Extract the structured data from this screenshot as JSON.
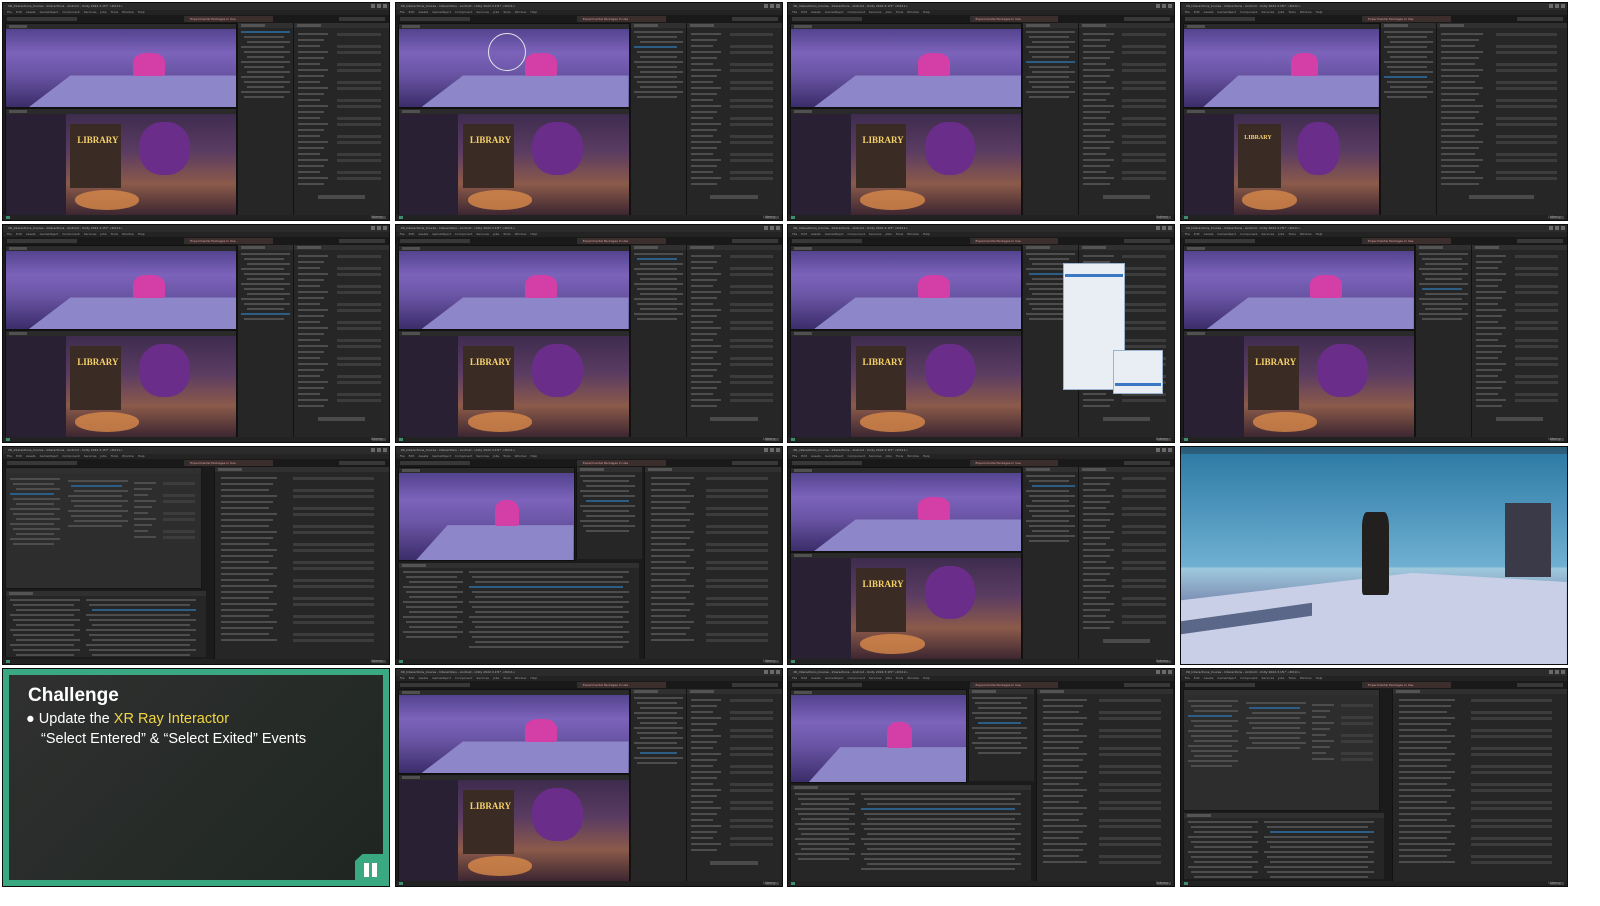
{
  "window": {
    "title": "XR_Interactions_Course - Interactions - Android - Unity 2022.3.1f1* <DX11>"
  },
  "menu": [
    "File",
    "Edit",
    "Assets",
    "GameObject",
    "Component",
    "Services",
    "Jobs",
    "Tools",
    "Window",
    "Help"
  ],
  "toolbar": {
    "experimental_label": "Experimental Packages In Use",
    "layers_label": "Layers",
    "layout_label": "Layout"
  },
  "scene": {
    "library_sign": "LIBRARY"
  },
  "challenge": {
    "title": "Challenge",
    "bullet": "●",
    "line1_before": "Update the ",
    "line1_highlight": "XR Ray Interactor",
    "line2": "“Select Entered” & “Select Exited” Events",
    "accent_color": "#3aa880",
    "highlight_color": "#f2d645",
    "pause_icon": "pause-icon"
  },
  "brand": "Udemy",
  "tiles": [
    {
      "id": "t1",
      "kind": "editor",
      "view": "dual",
      "panel": "inspector"
    },
    {
      "id": "t2",
      "kind": "editor",
      "view": "dual-gizmo",
      "panel": "inspector"
    },
    {
      "id": "t3",
      "kind": "editor",
      "view": "dual",
      "panel": "inspector"
    },
    {
      "id": "t4",
      "kind": "editor",
      "view": "dual",
      "panel": "inspector-wide"
    },
    {
      "id": "t5",
      "kind": "editor",
      "view": "dual",
      "panel": "inspector"
    },
    {
      "id": "t6",
      "kind": "editor",
      "view": "dual",
      "panel": "inspector"
    },
    {
      "id": "t7",
      "kind": "editor",
      "view": "dual",
      "panel": "inspector-dropdown"
    },
    {
      "id": "t8",
      "kind": "editor",
      "view": "dual",
      "panel": "inspector"
    },
    {
      "id": "t9",
      "kind": "editor",
      "view": "input-actions",
      "panel": "inspector"
    },
    {
      "id": "t10",
      "kind": "editor",
      "view": "project",
      "panel": "inspector"
    },
    {
      "id": "t11",
      "kind": "editor",
      "view": "dual",
      "panel": "inspector"
    },
    {
      "id": "t12",
      "kind": "game",
      "view": "fullscreen",
      "panel": "none"
    },
    {
      "id": "t13",
      "kind": "challenge",
      "view": "challenge",
      "panel": "none"
    },
    {
      "id": "t14",
      "kind": "editor",
      "view": "dual",
      "panel": "inspector"
    },
    {
      "id": "t15",
      "kind": "editor",
      "view": "project",
      "panel": "inspector"
    },
    {
      "id": "t16",
      "kind": "editor",
      "view": "input-actions",
      "panel": "inspector"
    }
  ]
}
